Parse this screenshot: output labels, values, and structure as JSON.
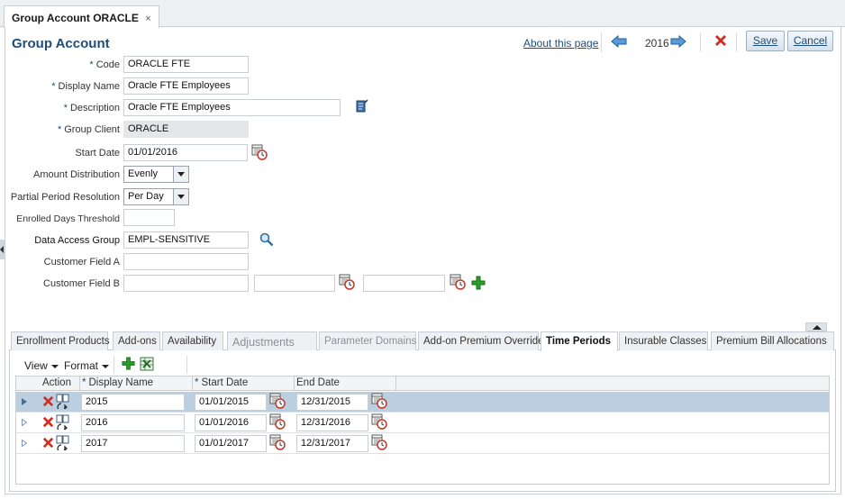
{
  "document_tab": {
    "label": "Group Account ORACLE",
    "close_glyph": "×"
  },
  "page": {
    "title": "Group Account"
  },
  "toolbar": {
    "about_label": "About this page",
    "year": "2016",
    "save_label": "Save",
    "cancel_label": "Cancel"
  },
  "form": {
    "code": {
      "label": "Code",
      "value": "ORACLE FTE"
    },
    "display_name": {
      "label": "Display Name",
      "value": "Oracle FTE Employees"
    },
    "description": {
      "label": "Description",
      "value": "Oracle FTE Employees"
    },
    "group_client": {
      "label": "Group Client",
      "value": "ORACLE"
    },
    "start_date": {
      "label": "Start Date",
      "value": "01/01/2016"
    },
    "amount_distribution": {
      "label": "Amount Distribution",
      "value": "Evenly"
    },
    "partial_period_resolution": {
      "label": "Partial Period Resolution",
      "value": "Per Day"
    },
    "enrolled_days_threshold": {
      "label": "Enrolled Days Threshold",
      "value": ""
    },
    "data_access_group": {
      "label": "Data Access Group",
      "value": "EMPL-SENSITIVE"
    },
    "customer_field_a": {
      "label": "Customer Field A",
      "value": ""
    },
    "customer_field_b": {
      "label": "Customer Field B",
      "value": ""
    }
  },
  "required_marker": "*",
  "subtabs": [
    {
      "label": "Enrollment Products",
      "state": "normal"
    },
    {
      "label": "Add-ons",
      "state": "normal"
    },
    {
      "label": "Availability",
      "state": "normal"
    },
    {
      "label": "Adjustments",
      "state": "disabled"
    },
    {
      "label": "Parameter Domains",
      "state": "disabled"
    },
    {
      "label": "Add-on Premium Overrides",
      "state": "normal"
    },
    {
      "label": "Time Periods",
      "state": "active"
    },
    {
      "label": "Insurable Classes",
      "state": "normal"
    },
    {
      "label": "Premium Bill Allocations",
      "state": "normal"
    }
  ],
  "table": {
    "view_label": "View",
    "format_label": "Format",
    "columns": {
      "action": "Action",
      "display_name": "Display Name",
      "start_date": "Start Date",
      "end_date": "End Date"
    },
    "rows": [
      {
        "display_name": "2015",
        "start_date": "01/01/2015",
        "end_date": "12/31/2015",
        "selected": true
      },
      {
        "display_name": "2016",
        "start_date": "01/01/2016",
        "end_date": "12/31/2016",
        "selected": false
      },
      {
        "display_name": "2017",
        "start_date": "01/01/2017",
        "end_date": "12/31/2017",
        "selected": false
      }
    ]
  },
  "colors": {
    "accent": "#1f4e79",
    "selected_row": "#bccfe0",
    "delete": "#d42b1e",
    "add": "#2a9c2a"
  },
  "icons": [
    "close-icon",
    "arrow-left-icon",
    "arrow-right-icon",
    "delete-icon",
    "notes-icon",
    "calendar-icon",
    "search-icon",
    "add-icon",
    "export-excel-icon",
    "row-delete-icon",
    "row-copy-icon",
    "row-expand-icon"
  ]
}
